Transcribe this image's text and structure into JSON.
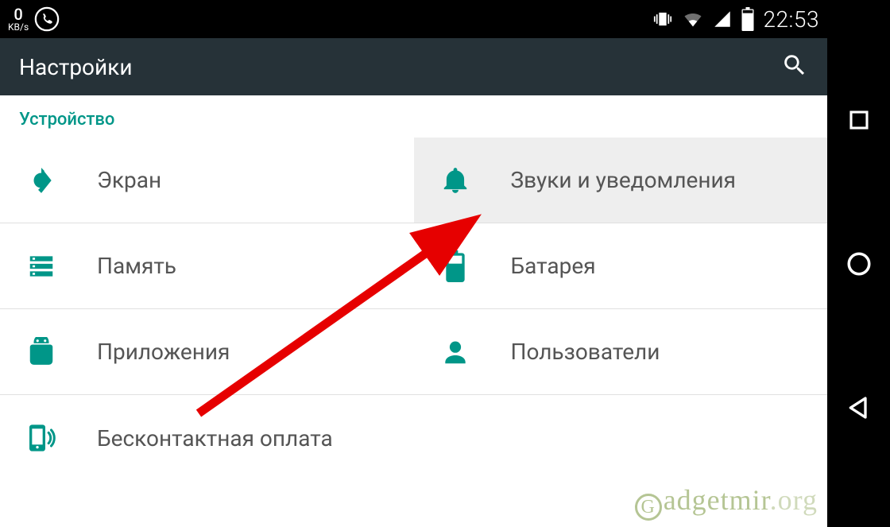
{
  "statusbar": {
    "speed_value": "0",
    "speed_unit": "KB/s",
    "time": "22:53"
  },
  "actionbar": {
    "title": "Настройки"
  },
  "section": {
    "title": "Устройство"
  },
  "items": {
    "display": "Экран",
    "sound": "Звуки и уведомления",
    "storage": "Память",
    "battery": "Батарея",
    "apps": "Приложения",
    "users": "Пользователи",
    "nfc": "Бесконтактная оплата"
  },
  "watermark": {
    "text_a": "adgetmir",
    "text_b": ".org"
  }
}
